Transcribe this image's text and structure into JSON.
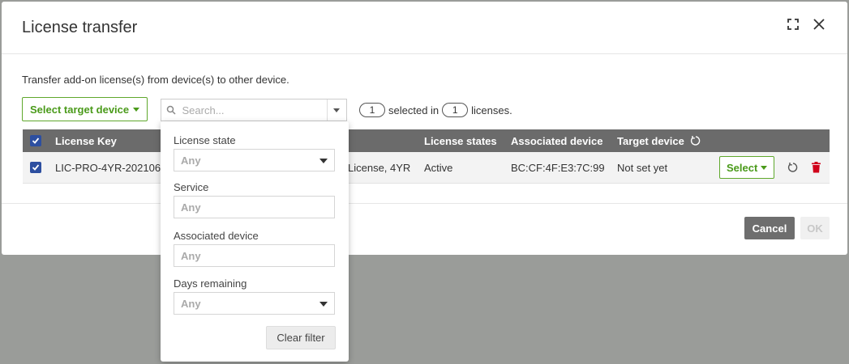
{
  "modal": {
    "title": "License transfer",
    "description": "Transfer add-on license(s) from device(s) to other device."
  },
  "toolbar": {
    "select_target_label": "Select target device",
    "search_placeholder": "Search...",
    "selected_count": "1",
    "selected_in_text": "selected in",
    "total_count": "1",
    "licenses_text": "licenses."
  },
  "table": {
    "columns": {
      "license_key": "License Key",
      "license_states": "License states",
      "associated_device": "Associated device",
      "target_device": "Target device"
    },
    "rows": [
      {
        "checked": true,
        "license_key": "LIC-PRO-4YR-202106",
        "license_name": "License, 4YR",
        "state": "Active",
        "associated_device": "BC:CF:4F:E3:7C:99",
        "target_device": "Not set yet",
        "select_label": "Select"
      }
    ]
  },
  "footer": {
    "cancel_label": "Cancel",
    "ok_label": "OK"
  },
  "filter": {
    "license_state_label": "License state",
    "license_state_value": "Any",
    "service_label": "Service",
    "service_placeholder": "Any",
    "associated_device_label": "Associated device",
    "associated_device_placeholder": "Any",
    "days_remaining_label": "Days remaining",
    "days_remaining_value": "Any",
    "clear_label": "Clear filter"
  },
  "colors": {
    "accent_green": "#5fa82c",
    "header_gray": "#6b6b6b",
    "checkbox_blue": "#2d4fa0",
    "delete_red": "#d0021b"
  }
}
